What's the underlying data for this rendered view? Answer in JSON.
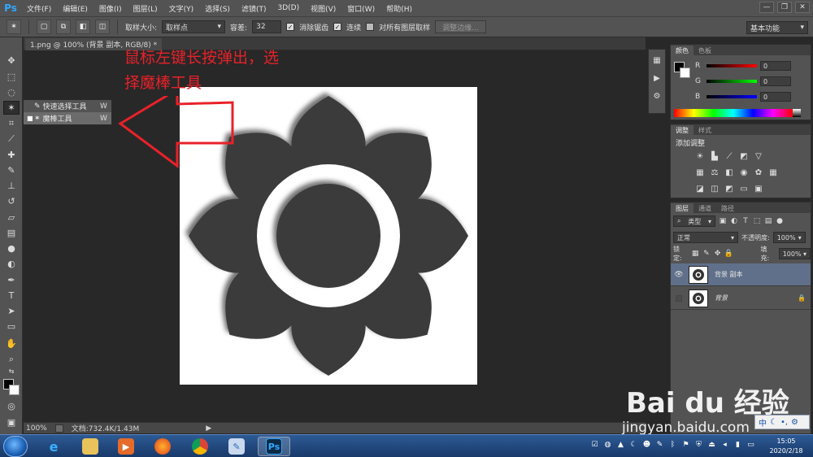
{
  "app": {
    "logo": "Ps"
  },
  "menu": [
    "文件(F)",
    "编辑(E)",
    "图像(I)",
    "图层(L)",
    "文字(Y)",
    "选择(S)",
    "滤镜(T)",
    "3D(D)",
    "视图(V)",
    "窗口(W)",
    "帮助(H)"
  ],
  "window_controls": {
    "minimize": "—",
    "restore": "❐",
    "close": "✕"
  },
  "options": {
    "sample_size_label": "取样大小:",
    "sample_size_value": "取样点",
    "tolerance_label": "容差:",
    "tolerance_value": "32",
    "antialias_label": "消除锯齿",
    "contiguous_label": "连续",
    "sample_all_label": "对所有图层取样",
    "refine_edge_label": "调整边缘...",
    "workspace": "基本功能"
  },
  "flyout": {
    "items": [
      {
        "label": "快速选择工具",
        "shortcut": "W",
        "selected": false
      },
      {
        "label": "魔棒工具",
        "shortcut": "W",
        "selected": true
      }
    ]
  },
  "document": {
    "tab_title": "1.png @ 100% (背景 副本, RGB/8) *",
    "close": "×"
  },
  "annotation": {
    "line1": "鼠标左键长按弹出，选",
    "line2": "择魔棒工具"
  },
  "status": {
    "zoom": "100%",
    "doc_info": "文档:732.4K/1.43M"
  },
  "color_panel": {
    "tabs": [
      "颜色",
      "色板"
    ],
    "channels": [
      {
        "label": "R",
        "value": "0",
        "color": "#ff0000"
      },
      {
        "label": "G",
        "value": "0",
        "color": "#00ff00"
      },
      {
        "label": "B",
        "value": "0",
        "color": "#0000ff"
      }
    ]
  },
  "adjust_panel": {
    "tabs": [
      "调整",
      "样式"
    ],
    "title": "添加调整"
  },
  "layers_panel": {
    "tabs": [
      "图层",
      "通道",
      "路径"
    ],
    "filter_type": "类型",
    "blend_mode": "正常",
    "opacity_label": "不透明度:",
    "opacity_value": "100%",
    "lock_label": "锁定:",
    "fill_label": "填充:",
    "fill_value": "100%",
    "layers": [
      {
        "name": "背景 副本",
        "visible": true,
        "selected": true,
        "locked": false
      },
      {
        "name": "背景",
        "visible": false,
        "selected": false,
        "locked": true
      }
    ]
  },
  "watermark": {
    "logo": "Bai du 经验",
    "url": "jingyan.baidu.com"
  },
  "ime": {
    "mode": "中"
  },
  "taskbar": {
    "ps_label": "Ps",
    "clock_time": "15:05",
    "clock_date": "2020/2/18"
  }
}
